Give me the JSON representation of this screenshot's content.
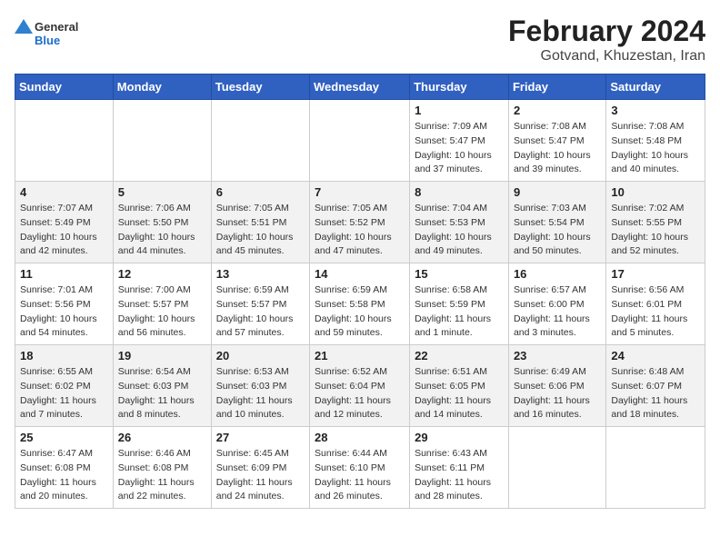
{
  "header": {
    "logo_general": "General",
    "logo_blue": "Blue",
    "month_title": "February 2024",
    "subtitle": "Gotvand, Khuzestan, Iran"
  },
  "weekdays": [
    "Sunday",
    "Monday",
    "Tuesday",
    "Wednesday",
    "Thursday",
    "Friday",
    "Saturday"
  ],
  "weeks": [
    [
      {
        "day": "",
        "info": ""
      },
      {
        "day": "",
        "info": ""
      },
      {
        "day": "",
        "info": ""
      },
      {
        "day": "",
        "info": ""
      },
      {
        "day": "1",
        "info": "Sunrise: 7:09 AM\nSunset: 5:47 PM\nDaylight: 10 hours\nand 37 minutes."
      },
      {
        "day": "2",
        "info": "Sunrise: 7:08 AM\nSunset: 5:47 PM\nDaylight: 10 hours\nand 39 minutes."
      },
      {
        "day": "3",
        "info": "Sunrise: 7:08 AM\nSunset: 5:48 PM\nDaylight: 10 hours\nand 40 minutes."
      }
    ],
    [
      {
        "day": "4",
        "info": "Sunrise: 7:07 AM\nSunset: 5:49 PM\nDaylight: 10 hours\nand 42 minutes."
      },
      {
        "day": "5",
        "info": "Sunrise: 7:06 AM\nSunset: 5:50 PM\nDaylight: 10 hours\nand 44 minutes."
      },
      {
        "day": "6",
        "info": "Sunrise: 7:05 AM\nSunset: 5:51 PM\nDaylight: 10 hours\nand 45 minutes."
      },
      {
        "day": "7",
        "info": "Sunrise: 7:05 AM\nSunset: 5:52 PM\nDaylight: 10 hours\nand 47 minutes."
      },
      {
        "day": "8",
        "info": "Sunrise: 7:04 AM\nSunset: 5:53 PM\nDaylight: 10 hours\nand 49 minutes."
      },
      {
        "day": "9",
        "info": "Sunrise: 7:03 AM\nSunset: 5:54 PM\nDaylight: 10 hours\nand 50 minutes."
      },
      {
        "day": "10",
        "info": "Sunrise: 7:02 AM\nSunset: 5:55 PM\nDaylight: 10 hours\nand 52 minutes."
      }
    ],
    [
      {
        "day": "11",
        "info": "Sunrise: 7:01 AM\nSunset: 5:56 PM\nDaylight: 10 hours\nand 54 minutes."
      },
      {
        "day": "12",
        "info": "Sunrise: 7:00 AM\nSunset: 5:57 PM\nDaylight: 10 hours\nand 56 minutes."
      },
      {
        "day": "13",
        "info": "Sunrise: 6:59 AM\nSunset: 5:57 PM\nDaylight: 10 hours\nand 57 minutes."
      },
      {
        "day": "14",
        "info": "Sunrise: 6:59 AM\nSunset: 5:58 PM\nDaylight: 10 hours\nand 59 minutes."
      },
      {
        "day": "15",
        "info": "Sunrise: 6:58 AM\nSunset: 5:59 PM\nDaylight: 11 hours\nand 1 minute."
      },
      {
        "day": "16",
        "info": "Sunrise: 6:57 AM\nSunset: 6:00 PM\nDaylight: 11 hours\nand 3 minutes."
      },
      {
        "day": "17",
        "info": "Sunrise: 6:56 AM\nSunset: 6:01 PM\nDaylight: 11 hours\nand 5 minutes."
      }
    ],
    [
      {
        "day": "18",
        "info": "Sunrise: 6:55 AM\nSunset: 6:02 PM\nDaylight: 11 hours\nand 7 minutes."
      },
      {
        "day": "19",
        "info": "Sunrise: 6:54 AM\nSunset: 6:03 PM\nDaylight: 11 hours\nand 8 minutes."
      },
      {
        "day": "20",
        "info": "Sunrise: 6:53 AM\nSunset: 6:03 PM\nDaylight: 11 hours\nand 10 minutes."
      },
      {
        "day": "21",
        "info": "Sunrise: 6:52 AM\nSunset: 6:04 PM\nDaylight: 11 hours\nand 12 minutes."
      },
      {
        "day": "22",
        "info": "Sunrise: 6:51 AM\nSunset: 6:05 PM\nDaylight: 11 hours\nand 14 minutes."
      },
      {
        "day": "23",
        "info": "Sunrise: 6:49 AM\nSunset: 6:06 PM\nDaylight: 11 hours\nand 16 minutes."
      },
      {
        "day": "24",
        "info": "Sunrise: 6:48 AM\nSunset: 6:07 PM\nDaylight: 11 hours\nand 18 minutes."
      }
    ],
    [
      {
        "day": "25",
        "info": "Sunrise: 6:47 AM\nSunset: 6:08 PM\nDaylight: 11 hours\nand 20 minutes."
      },
      {
        "day": "26",
        "info": "Sunrise: 6:46 AM\nSunset: 6:08 PM\nDaylight: 11 hours\nand 22 minutes."
      },
      {
        "day": "27",
        "info": "Sunrise: 6:45 AM\nSunset: 6:09 PM\nDaylight: 11 hours\nand 24 minutes."
      },
      {
        "day": "28",
        "info": "Sunrise: 6:44 AM\nSunset: 6:10 PM\nDaylight: 11 hours\nand 26 minutes."
      },
      {
        "day": "29",
        "info": "Sunrise: 6:43 AM\nSunset: 6:11 PM\nDaylight: 11 hours\nand 28 minutes."
      },
      {
        "day": "",
        "info": ""
      },
      {
        "day": "",
        "info": ""
      }
    ]
  ]
}
